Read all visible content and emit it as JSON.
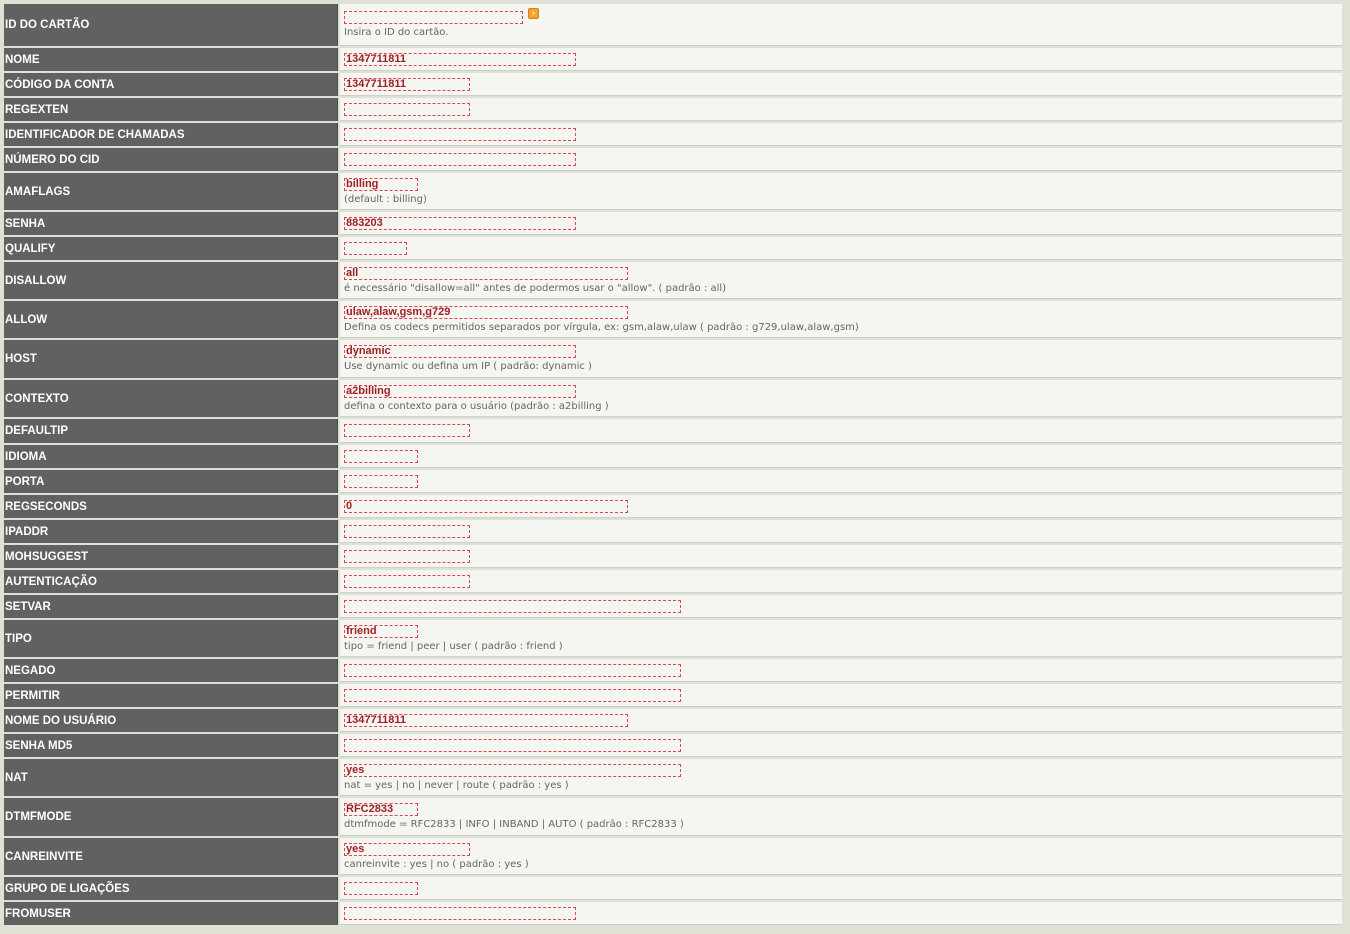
{
  "form": {
    "card_id": {
      "label": "ID DO CARTÃO",
      "value": "",
      "hint": "Insira o ID do cartão."
    },
    "nome": {
      "label": "NOME",
      "value": "1347711811"
    },
    "codigo_conta": {
      "label": "CÓDIGO DA CONTA",
      "value": "1347711811"
    },
    "regexten": {
      "label": "REGEXTEN",
      "value": ""
    },
    "identificador_chamadas": {
      "label": "IDENTIFICADOR DE CHAMADAS",
      "value": ""
    },
    "numero_cid": {
      "label": "NÚMERO DO CID",
      "value": ""
    },
    "amaflags": {
      "label": "AMAFLAGS",
      "value": "billing",
      "hint": "(default : billing)"
    },
    "senha": {
      "label": "SENHA",
      "value": "883203"
    },
    "qualify": {
      "label": "QUALIFY",
      "value": ""
    },
    "disallow": {
      "label": "DISALLOW",
      "value": "all",
      "hint": "é necessário \"disallow=all\" antes de podermos usar o \"allow\". ( padrão : all)"
    },
    "allow": {
      "label": "ALLOW",
      "value": "ulaw,alaw,gsm,g729",
      "hint": "Defina os codecs permitidos separados por vírgula, ex: gsm,alaw,ulaw ( padrão : g729,ulaw,alaw,gsm)"
    },
    "host": {
      "label": "HOST",
      "value": "dynamic",
      "hint": "Use dynamic ou defina um IP ( padrão: dynamic )"
    },
    "contexto": {
      "label": "CONTEXTO",
      "value": "a2billing",
      "hint": "defina o contexto para o usuário (padrão : a2billing )"
    },
    "defaultip": {
      "label": "DEFAULTIP",
      "value": ""
    },
    "idioma": {
      "label": "IDIOMA",
      "value": ""
    },
    "porta": {
      "label": "PORTA",
      "value": ""
    },
    "regseconds": {
      "label": "REGSECONDS",
      "value": "0"
    },
    "ipaddr": {
      "label": "IPADDR",
      "value": ""
    },
    "mohsuggest": {
      "label": "MOHSUGGEST",
      "value": ""
    },
    "autenticacao": {
      "label": "AUTENTICAÇÃO",
      "value": ""
    },
    "setvar": {
      "label": "SETVAR",
      "value": ""
    },
    "tipo": {
      "label": "TIPO",
      "value": "friend",
      "hint": "tipo = friend | peer | user ( padrão : friend )"
    },
    "negado": {
      "label": "NEGADO",
      "value": ""
    },
    "permitir": {
      "label": "PERMITIR",
      "value": ""
    },
    "nome_usuario": {
      "label": "NOME DO USUÁRIO",
      "value": "1347711811"
    },
    "senha_md5": {
      "label": "SENHA MD5",
      "value": ""
    },
    "nat": {
      "label": "NAT",
      "value": "yes",
      "hint": "nat = yes | no | never | route ( padrão : yes )"
    },
    "dtmfmode": {
      "label": "DTMFMODE",
      "value": "RFC2833",
      "hint": "dtmfmode = RFC2833 | INFO | INBAND | AUTO ( padrão : RFC2833 )"
    },
    "canreinvite": {
      "label": "CANREINVITE",
      "value": "yes",
      "hint": "canreinvite : yes | no ( padrão : yes )"
    },
    "grupo_ligacoes": {
      "label": "GRUPO DE LIGAÇÕES",
      "value": ""
    },
    "fromuser": {
      "label": "FROMUSER",
      "value": ""
    }
  },
  "icons": {
    "card_lookup": "arrow-right-icon"
  },
  "colors": {
    "label_bg": "#616161",
    "field_border": "#d9474f",
    "field_text": "#a01f24",
    "value_bg": "#f5f5f1"
  }
}
